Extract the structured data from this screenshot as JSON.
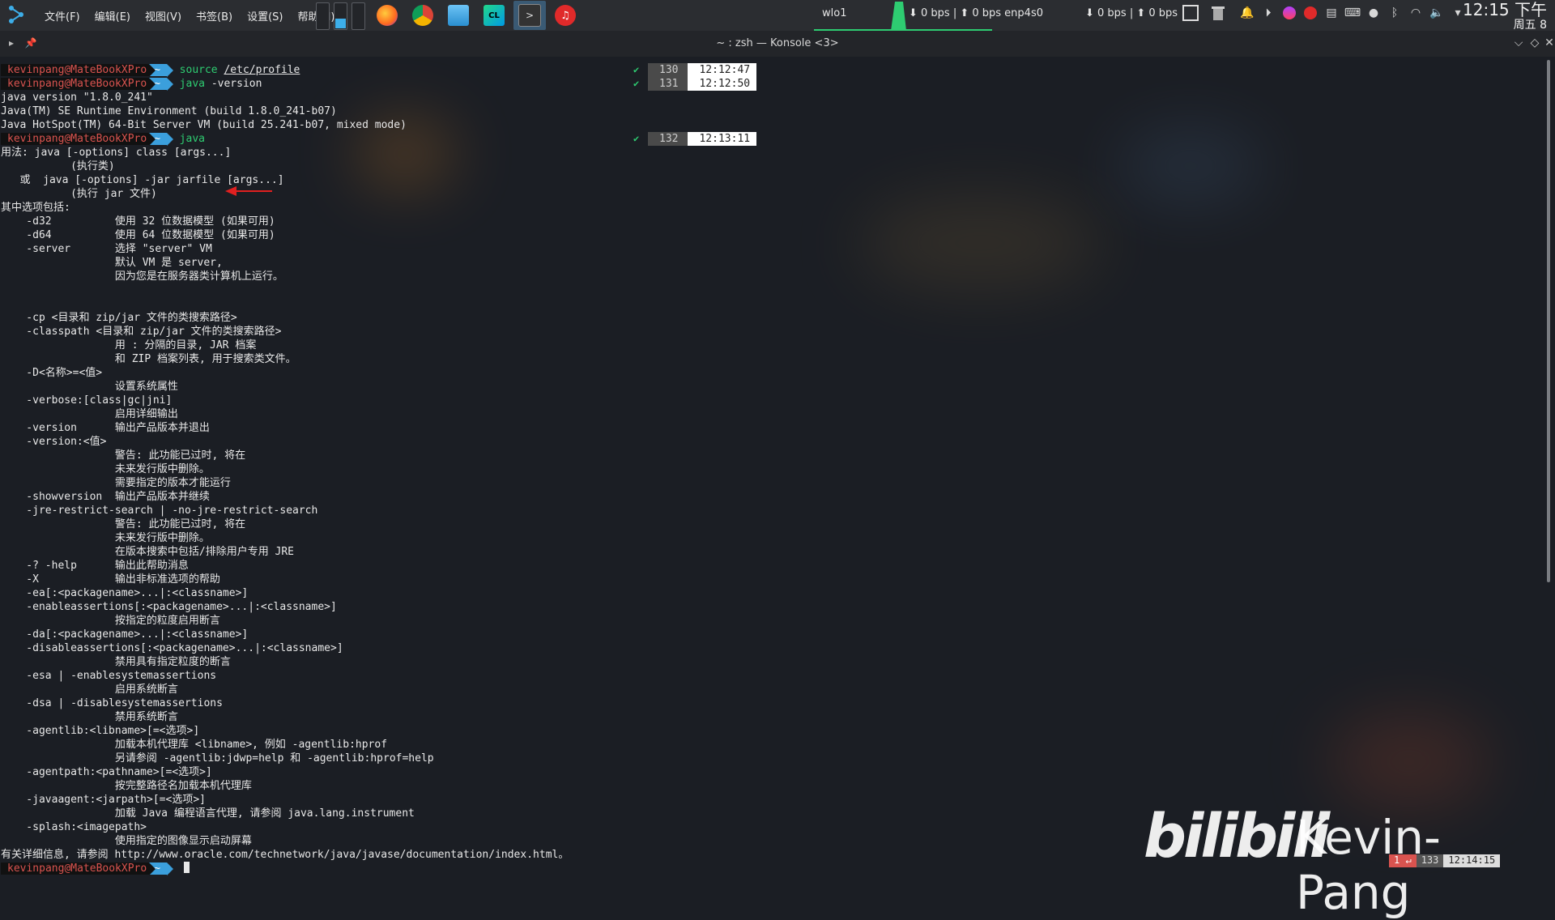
{
  "panel": {
    "menus": [
      "文件(F)",
      "编辑(E)",
      "视图(V)",
      "书签(B)",
      "设置(S)",
      "帮助(H)"
    ],
    "network": {
      "iface": "wlo1",
      "stat1": "⬇ 0 bps | ⬆ 0 bps enp4s0",
      "stat2": "⬇ 0 bps | ⬆ 0 bps"
    },
    "clock": {
      "time": "12:15 下午",
      "day": "周五 8"
    }
  },
  "window": {
    "title": "~ : zsh — Konsole <3>"
  },
  "terminal": {
    "prompt_user": "kevinpang@MateBookXPro",
    "prompt_dir": "~",
    "commands": [
      {
        "cmd": "source",
        "arg": "/etc/profile",
        "num": "130",
        "time": "12:12:47"
      },
      {
        "cmd": "java",
        "arg": "-version",
        "num": "131",
        "time": "12:12:50"
      },
      {
        "cmd": "java",
        "arg": "",
        "num": "132",
        "time": "12:13:11"
      }
    ],
    "version_output": [
      "java version \"1.8.0_241\"",
      "Java(TM) SE Runtime Environment (build 1.8.0_241-b07)",
      "Java HotSpot(TM) 64-Bit Server VM (build 25.241-b07, mixed mode)"
    ],
    "usage_output": [
      "用法: java [-options] class [args...]",
      "           (执行类)",
      "   或  java [-options] -jar jarfile [args...]",
      "           (执行 jar 文件)",
      "其中选项包括:",
      "    -d32          使用 32 位数据模型 (如果可用)",
      "    -d64          使用 64 位数据模型 (如果可用)",
      "    -server       选择 \"server\" VM",
      "                  默认 VM 是 server,",
      "                  因为您是在服务器类计算机上运行。",
      "",
      "",
      "    -cp <目录和 zip/jar 文件的类搜索路径>",
      "    -classpath <目录和 zip/jar 文件的类搜索路径>",
      "                  用 : 分隔的目录, JAR 档案",
      "                  和 ZIP 档案列表, 用于搜索类文件。",
      "    -D<名称>=<值>",
      "                  设置系统属性",
      "    -verbose:[class|gc|jni]",
      "                  启用详细输出",
      "    -version      输出产品版本并退出",
      "    -version:<值>",
      "                  警告: 此功能已过时, 将在",
      "                  未来发行版中删除。",
      "                  需要指定的版本才能运行",
      "    -showversion  输出产品版本并继续",
      "    -jre-restrict-search | -no-jre-restrict-search",
      "                  警告: 此功能已过时, 将在",
      "                  未来发行版中删除。",
      "                  在版本搜索中包括/排除用户专用 JRE",
      "    -? -help      输出此帮助消息",
      "    -X            输出非标准选项的帮助",
      "    -ea[:<packagename>...|:<classname>]",
      "    -enableassertions[:<packagename>...|:<classname>]",
      "                  按指定的粒度启用断言",
      "    -da[:<packagename>...|:<classname>]",
      "    -disableassertions[:<packagename>...|:<classname>]",
      "                  禁用具有指定粒度的断言",
      "    -esa | -enablesystemassertions",
      "                  启用系统断言",
      "    -dsa | -disablesystemassertions",
      "                  禁用系统断言",
      "    -agentlib:<libname>[=<选项>]",
      "                  加载本机代理库 <libname>, 例如 -agentlib:hprof",
      "                  另请参阅 -agentlib:jdwp=help 和 -agentlib:hprof=help",
      "    -agentpath:<pathname>[=<选项>]",
      "                  按完整路径名加载本机代理库",
      "    -javaagent:<jarpath>[=<选项>]",
      "                  加载 Java 编程语言代理, 请参阅 java.lang.instrument",
      "    -splash:<imagepath>",
      "                  使用指定的图像显示启动屏幕",
      "有关详细信息, 请参阅 http://www.oracle.com/technetwork/java/javase/documentation/index.html。"
    ],
    "mini_status": {
      "a": "1 ↵",
      "b": "133",
      "c": "12:14:15"
    }
  },
  "watermark": {
    "brand": "bilibili",
    "name": "Kevin-Pang"
  },
  "colors": {
    "accent": "#3daee9",
    "prompt_user": "#d9534f",
    "cmd": "#2ecc71",
    "panel": "#2b2d31"
  }
}
